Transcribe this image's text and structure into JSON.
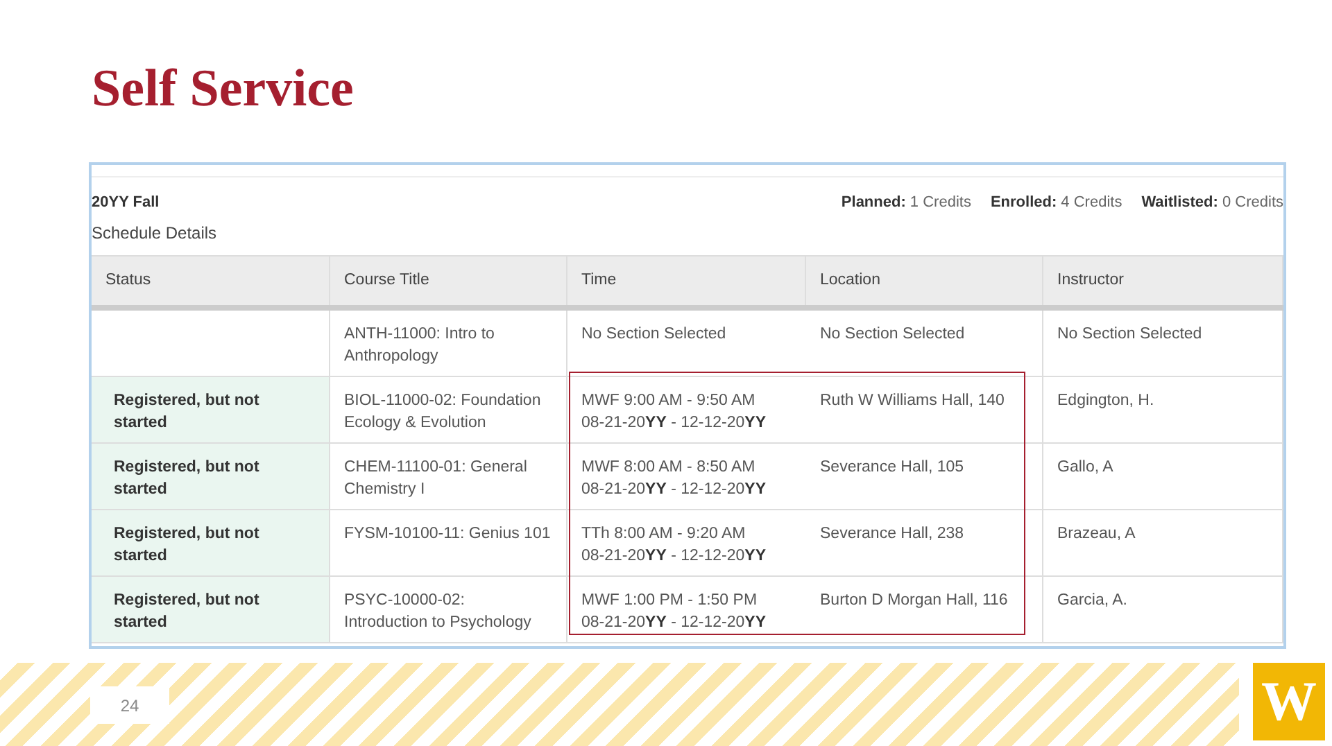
{
  "slide_title": "Self Service",
  "term": {
    "name": "20YY Fall",
    "subtitle": "Schedule Details",
    "credits": [
      "**Planned:** 1 Credits",
      "**Enrolled:** 4 Credits",
      "**Waitlisted:** 0 Credits"
    ]
  },
  "table": {
    "columns": [
      "Status",
      "Course Title",
      "Time",
      "Location",
      "Instructor"
    ],
    "rows": [
      {
        "course": "ANTH-11000: Intro to Anthropology",
        "time": [
          "No Section Selected"
        ],
        "location": "No Section Selected",
        "instructor": "No Section Selected"
      },
      {
        "status": "Registered, but not started",
        "course": "BIOL-11000-02: Foundation Ecology & Evolution",
        "time": [
          "MWF 9:00 AM - 9:50 AM",
          "08-21-20**YY** - 12-12-20**YY**"
        ],
        "location": "Ruth W Williams Hall, 140",
        "instructor": "Edgington, H."
      },
      {
        "status": "Registered, but not started",
        "course": "CHEM-11100-01: General Chemistry I",
        "time": [
          "MWF 8:00 AM - 8:50 AM",
          "08-21-20**YY** - 12-12-20**YY**"
        ],
        "location": "Severance Hall, 105",
        "instructor": "Gallo, A"
      },
      {
        "status": "Registered, but not started",
        "course": "FYSM-10100-11: Genius 101",
        "time": [
          "TTh 8:00 AM - 9:20 AM",
          "08-21-20**YY** - 12-12-20**YY**"
        ],
        "location": "Severance Hall, 238",
        "instructor": "Brazeau, A"
      },
      {
        "status": "Registered, but not started",
        "course": "PSYC-10000-02: Introduction to Psychology",
        "time": [
          "MWF 1:00 PM - 1:50 PM",
          "08-21-20**YY** - 12-12-20**YY**"
        ],
        "location": "Burton D Morgan Hall, 116",
        "instructor": "Garcia, A."
      }
    ]
  },
  "page_number": "24",
  "logo": {
    "text": "W"
  }
}
